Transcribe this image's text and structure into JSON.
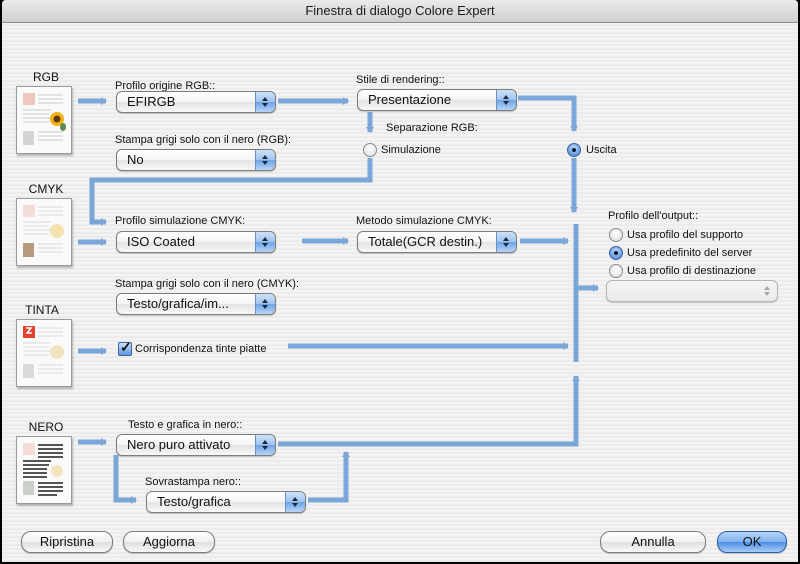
{
  "window": {
    "title": "Finestra di dialogo Colore Expert"
  },
  "sources": {
    "rgb": {
      "label": "RGB",
      "icon": "rgb-document-icon"
    },
    "cmyk": {
      "label": "CMYK",
      "icon": "cmyk-document-icon"
    },
    "tinta": {
      "label": "TINTA",
      "icon": "spot-color-document-icon"
    },
    "nero": {
      "label": "NERO",
      "icon": "black-document-icon"
    }
  },
  "rgb_section": {
    "profile_label": "Profilo origine RGB::",
    "profile_value": "EFIRGB",
    "gray_label": "Stampa grigi solo con il nero (RGB):",
    "gray_value": "No",
    "rendering_label": "Stile di rendering::",
    "rendering_value": "Presentazione",
    "separation_label": "Separazione RGB:",
    "separation_options": [
      {
        "label": "Simulazione",
        "selected": false
      },
      {
        "label": "Uscita",
        "selected": true
      }
    ]
  },
  "cmyk_section": {
    "profile_label": "Profilo simulazione CMYK:",
    "profile_value": "ISO Coated",
    "method_label": "Metodo simulazione CMYK:",
    "method_value": "Totale(GCR destin.)",
    "gray_label": "Stampa grigi solo con il nero (CMYK):",
    "gray_value": "Testo/grafica/im..."
  },
  "tinta_section": {
    "spot_match_label": "Corrispondenza tinte piatte",
    "spot_match_checked": true
  },
  "nero_section": {
    "text_graphics_label": "Testo e grafica in nero::",
    "text_graphics_value": "Nero puro attivato",
    "overprint_label": "Sovrastampa nero::",
    "overprint_value": "Testo/grafica"
  },
  "output_profile": {
    "label": "Profilo dell'output::",
    "options": [
      {
        "label": "Usa profilo del supporto",
        "selected": false
      },
      {
        "label": "Usa predefinito del server",
        "selected": true
      },
      {
        "label": "Usa profilo di destinazione",
        "selected": false
      }
    ],
    "destination_value": ""
  },
  "buttons": {
    "reset": "Ripristina",
    "update": "Aggiorna",
    "cancel": "Annulla",
    "ok": "OK"
  },
  "colors": {
    "connector": "#7ba7d8",
    "accent": "#4d8ee3"
  }
}
